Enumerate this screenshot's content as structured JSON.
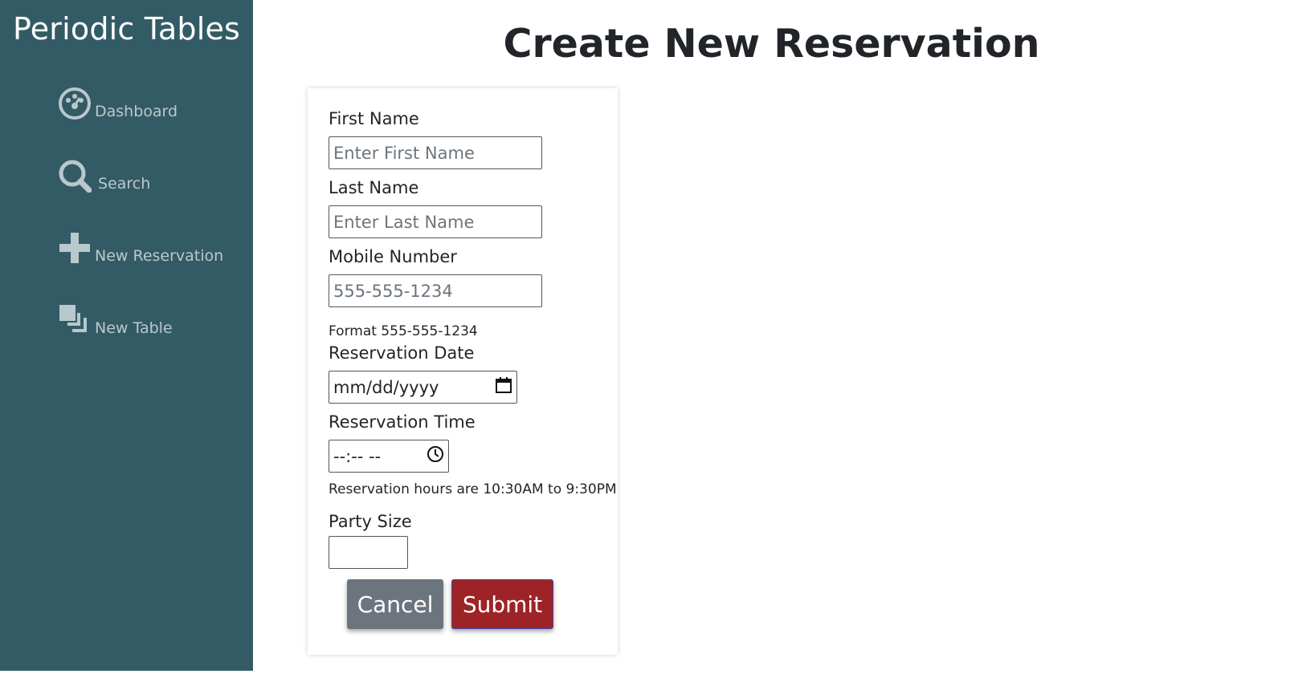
{
  "sidebar": {
    "brand": "Periodic Tables",
    "items": [
      {
        "label": "Dashboard",
        "icon": "dashboard-icon"
      },
      {
        "label": "Search",
        "icon": "search-icon"
      },
      {
        "label": "New Reservation",
        "icon": "plus-icon"
      },
      {
        "label": "New Table",
        "icon": "layers-icon"
      }
    ]
  },
  "page": {
    "title": "Create New Reservation"
  },
  "form": {
    "first_name": {
      "label": "First Name",
      "placeholder": "Enter First Name",
      "value": ""
    },
    "last_name": {
      "label": "Last Name",
      "placeholder": "Enter Last Name",
      "value": ""
    },
    "mobile": {
      "label": "Mobile Number",
      "placeholder": "555-555-1234",
      "value": "",
      "hint": "Format 555-555-1234"
    },
    "date": {
      "label": "Reservation Date",
      "display": "mm/dd/yyyy",
      "icon": "calendar-icon"
    },
    "time": {
      "label": "Reservation Time",
      "display": "--:-- --",
      "icon": "clock-icon",
      "hint": "Reservation hours are 10:30AM to 9:30PM"
    },
    "party_size": {
      "label": "Party Size",
      "value": ""
    },
    "cancel_label": "Cancel",
    "submit_label": "Submit"
  },
  "colors": {
    "sidebar": "#335b66",
    "nav_text": "#b9c8cc",
    "cancel": "#6c757d",
    "submit": "#9e2327"
  }
}
